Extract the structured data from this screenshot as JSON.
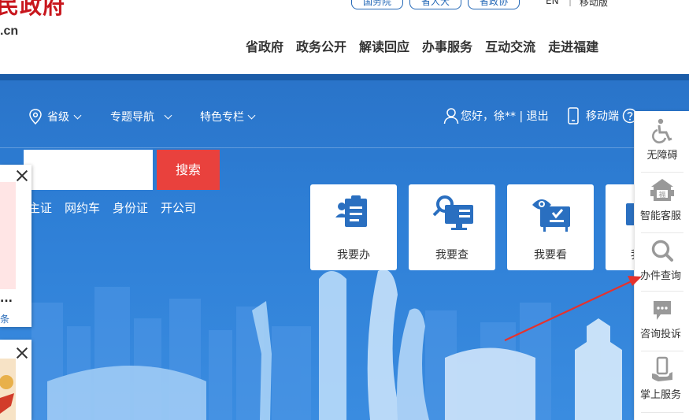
{
  "header": {
    "logo_text": "民政府",
    "logo_domain": ".cn",
    "site_links": [
      "国务院",
      "省人大",
      "省政协"
    ],
    "lang_en": "EN",
    "lang_separator": "|",
    "lang_mobile": "移动版",
    "main_nav": [
      "省政府",
      "政务公开",
      "解读回应",
      "办事服务",
      "互动交流",
      "走进福建"
    ]
  },
  "banner_nav": {
    "province": "省级",
    "topic_nav": "专题导航",
    "special": "特色专栏",
    "greeting": "您好，徐** | 退出",
    "mobile": "移动端",
    "help_icon": "question-circle-icon"
  },
  "search": {
    "placeholder": "",
    "button_label": "搜索",
    "hot_words": [
      "主证",
      "网约车",
      "身份证",
      "开公司"
    ]
  },
  "service_cards": [
    {
      "label": "我要办",
      "icon": "clipboard-person-icon"
    },
    {
      "label": "我要查",
      "icon": "magnifier-monitor-icon"
    },
    {
      "label": "我要看",
      "icon": "eye-board-icon"
    },
    {
      "label": "我",
      "icon": "partial-card-icon"
    }
  ],
  "left_popups": {
    "popup1_ellipsis": "...",
    "popup1_link_fragment": "条"
  },
  "float_sidebar": {
    "items": [
      {
        "label": "无障碍",
        "icon": "wheelchair-icon"
      },
      {
        "label": "智能客服",
        "icon": "robot-service-icon"
      },
      {
        "label": "办件查询",
        "icon": "search-icon"
      },
      {
        "label": "咨询投诉",
        "icon": "chat-bubble-icon"
      },
      {
        "label": "掌上服务",
        "icon": "hand-phone-icon"
      }
    ]
  },
  "colors": {
    "brand_red": "#c8161d",
    "banner_blue": "#2a74c9",
    "search_red": "#e9413d",
    "icon_blue": "#2a6fc0",
    "annotation_red": "#e5322d"
  }
}
